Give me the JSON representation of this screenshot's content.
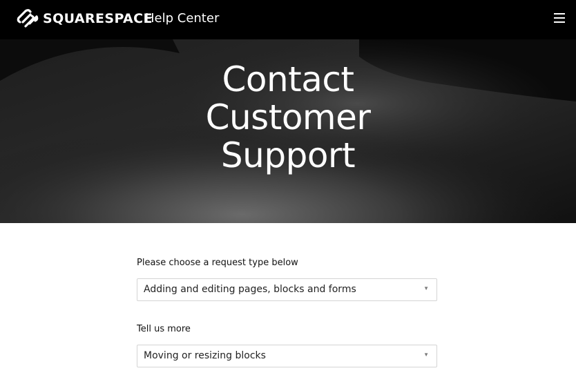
{
  "header": {
    "logo_icon": "squarespace-logo-icon",
    "brand": "SQUARESPACE",
    "section": "Help Center",
    "menu_icon": "hamburger-menu-icon"
  },
  "hero": {
    "title_lines": [
      "Contact",
      "Customer",
      "Support"
    ]
  },
  "form": {
    "request_type": {
      "label": "Please choose a request type below",
      "value": "Adding and editing pages, blocks and forms",
      "arrow": "▼"
    },
    "tell_more": {
      "label": "Tell us more",
      "value": "Moving or resizing blocks",
      "arrow": "▼"
    }
  },
  "colors": {
    "header_bg": "#000000",
    "hero_bg": "#151515",
    "text_light": "#ffffff",
    "border": "#d4d4d4"
  }
}
